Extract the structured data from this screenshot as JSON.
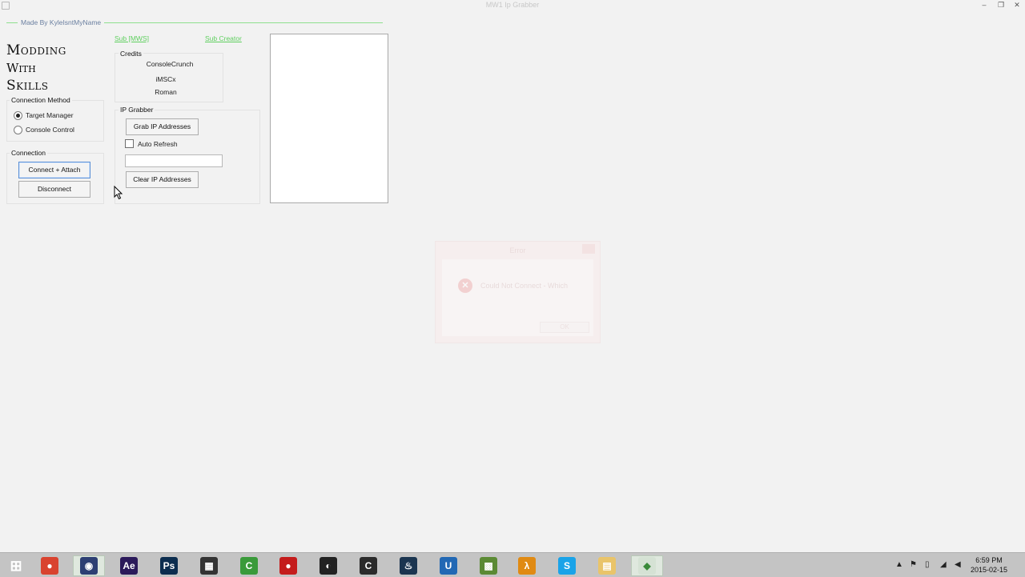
{
  "window": {
    "title": "MW1 Ip Grabber",
    "controls": {
      "minimize": "‒",
      "maximize": "❐",
      "close": "✕"
    }
  },
  "header": {
    "made_by": "Made By KyleIsntMyName",
    "logo_lines": [
      "Modding",
      "With",
      "Skills"
    ]
  },
  "links": {
    "sub_mws": "Sub [MWS]",
    "sub_creator": "Sub Creator"
  },
  "credits": {
    "title": "Credits",
    "names": [
      "ConsoleCrunch",
      "iMSCx",
      "Roman"
    ]
  },
  "connection_method": {
    "title": "Connection Method",
    "options": [
      {
        "label": "Target Manager",
        "selected": true
      },
      {
        "label": "Console Control",
        "selected": false
      }
    ]
  },
  "connection": {
    "title": "Connection",
    "connect_label": "Connect + Attach",
    "disconnect_label": "Disconnect"
  },
  "ip_grabber": {
    "title": "IP Grabber",
    "grab_label": "Grab IP Addresses",
    "auto_refresh_label": "Auto Refresh",
    "auto_refresh_checked": false,
    "textbox_value": "",
    "clear_label": "Clear IP Addresses"
  },
  "ip_list": {
    "items": []
  },
  "dialog": {
    "title": "Error",
    "message": "Could Not Connect - Which",
    "ok_label": "OK",
    "icon": "error-icon"
  },
  "taskbar": {
    "apps": [
      {
        "name": "start",
        "glyph": "⊞",
        "color": "#1a6fc7"
      },
      {
        "name": "chrome",
        "glyph": "●",
        "color": "#d9432f"
      },
      {
        "name": "cinema4d",
        "glyph": "◉",
        "color": "#2d3f73"
      },
      {
        "name": "after-effects",
        "glyph": "Ae",
        "color": "#2b1a5a"
      },
      {
        "name": "photoshop",
        "glyph": "Ps",
        "color": "#0c2d4f"
      },
      {
        "name": "video-editor",
        "glyph": "▦",
        "color": "#333333"
      },
      {
        "name": "camtasia",
        "glyph": "C",
        "color": "#3a9a3a"
      },
      {
        "name": "recorder",
        "glyph": "●",
        "color": "#c41c1c"
      },
      {
        "name": "obs",
        "glyph": "◐",
        "color": "#222222"
      },
      {
        "name": "console-app",
        "glyph": "C",
        "color": "#2b2b2b"
      },
      {
        "name": "steam",
        "glyph": "♨",
        "color": "#1b3550"
      },
      {
        "name": "uplay",
        "glyph": "U",
        "color": "#2268b4"
      },
      {
        "name": "minecraft",
        "glyph": "▩",
        "color": "#5b8a34"
      },
      {
        "name": "half-life",
        "glyph": "λ",
        "color": "#e08a13"
      },
      {
        "name": "skype",
        "glyph": "S",
        "color": "#1aa3e8"
      },
      {
        "name": "file-explorer",
        "glyph": "▤",
        "color": "#e9c46a"
      },
      {
        "name": "mw1-ip-grabber",
        "glyph": "◆",
        "color": "#d5e2d4"
      }
    ],
    "tray": {
      "time": "6:59 PM",
      "date": "2015-02-15"
    }
  },
  "colors": {
    "link": "#5fcf5f",
    "made_by_line": "#8ee08e",
    "taskbar": "#c4c4c4"
  }
}
